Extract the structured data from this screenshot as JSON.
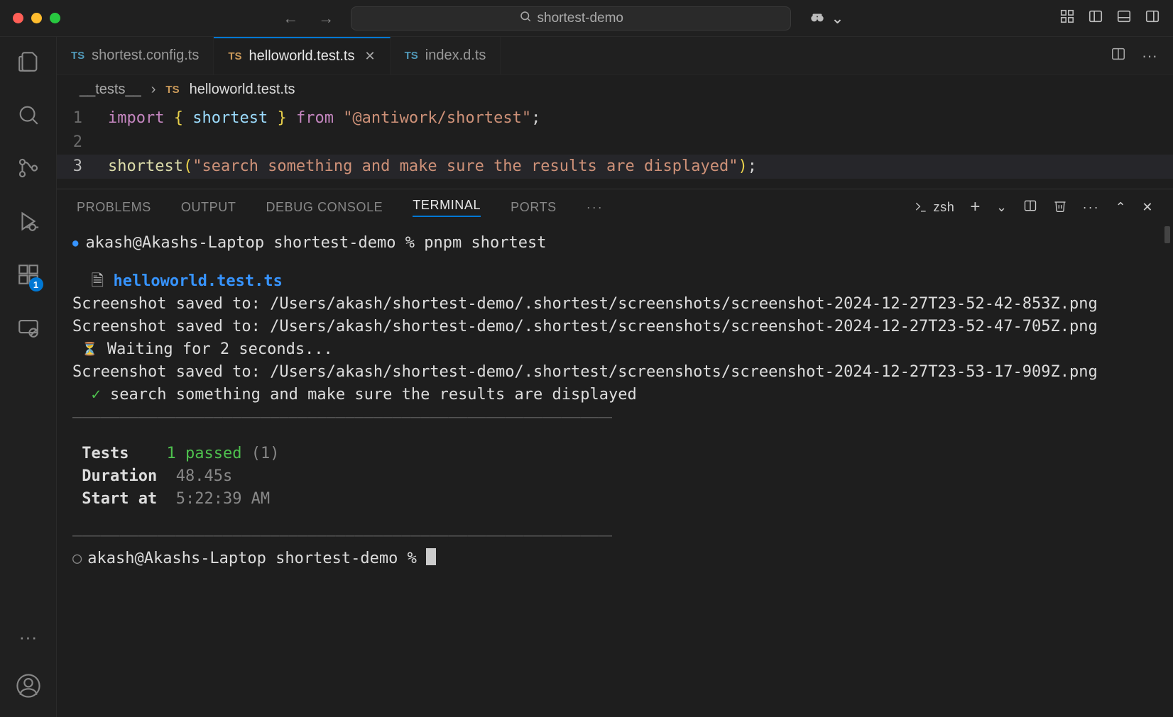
{
  "window": {
    "title": "shortest-demo"
  },
  "tabs": [
    {
      "label": "shortest.config.ts",
      "active": false
    },
    {
      "label": "helloworld.test.ts",
      "active": true
    },
    {
      "label": "index.d.ts",
      "active": false
    }
  ],
  "breadcrumb": {
    "folder": "__tests__",
    "sep": "›",
    "file": "helloworld.test.ts"
  },
  "code": {
    "lines": [
      "1",
      "2",
      "3"
    ],
    "l1": {
      "import": "import",
      "brace_open": " { ",
      "ident": "shortest",
      "brace_close": " } ",
      "from": "from",
      "space": " ",
      "str": "\"@antiwork/shortest\"",
      "semi": ";"
    },
    "l3": {
      "fn": "shortest",
      "paren_open": "(",
      "str": "\"search something and make sure the results are displayed\"",
      "paren_close": ")",
      "semi": ";"
    }
  },
  "panel": {
    "tabs": {
      "problems": "PROBLEMS",
      "output": "OUTPUT",
      "debug": "DEBUG CONSOLE",
      "terminal": "TERMINAL",
      "ports": "PORTS"
    },
    "shell": "zsh",
    "ellipsis": "···"
  },
  "terminal": {
    "prompt1": "akash@Akashs-Laptop shortest-demo % pnpm shortest",
    "file_icon": "🗎",
    "file": "helloworld.test.ts",
    "line_sc1": "Screenshot saved to: /Users/akash/shortest-demo/.shortest/screenshots/screenshot-2024-12-27T23-52-42-853Z.png",
    "line_sc2": "Screenshot saved to: /Users/akash/shortest-demo/.shortest/screenshots/screenshot-2024-12-27T23-52-47-705Z.png",
    "waiting": "⌛ Waiting for 2 seconds...",
    "line_sc3": "Screenshot saved to: /Users/akash/shortest-demo/.shortest/screenshots/screenshot-2024-12-27T23-53-17-909Z.png",
    "check": "✓",
    "pass_test": " search something and make sure the results are displayed",
    "summary": {
      "tests_label": "Tests",
      "tests_count": "1",
      "tests_status": "passed",
      "tests_total": "(1)",
      "duration_label": "Duration",
      "duration_value": "48.45s",
      "start_label": "Start at",
      "start_value": "5:22:39 AM"
    },
    "prompt2": "akash@Akashs-Laptop shortest-demo % ",
    "hr": "––––––––––––––––––––––––––––––––––––––––––––––––––––––––––––––––––––––––––––"
  },
  "activity": {
    "ext_badge": "1"
  }
}
